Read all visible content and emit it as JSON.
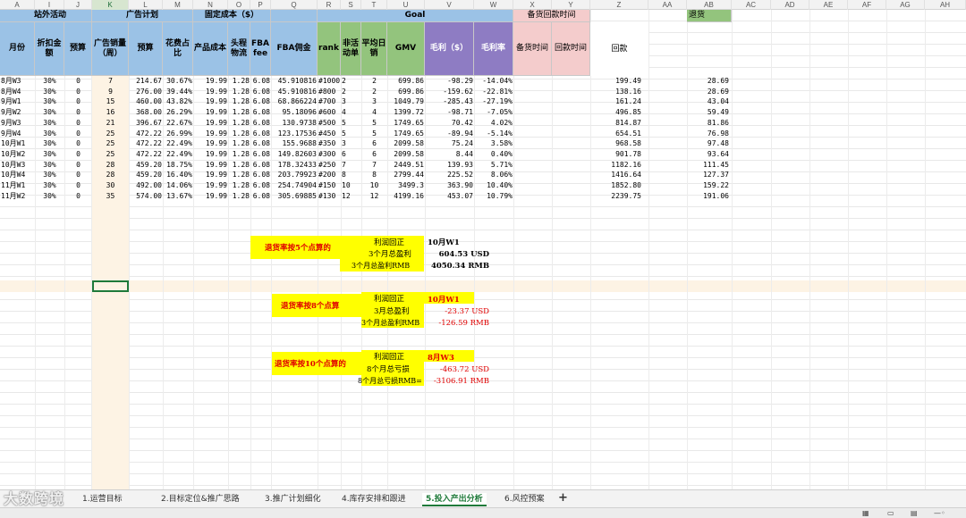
{
  "columns": [
    "A",
    "I",
    "J",
    "K",
    "L",
    "M",
    "N",
    "O",
    "P",
    "Q",
    "R",
    "S",
    "T",
    "U",
    "V",
    "W",
    "X",
    "Y",
    "Z",
    "AA",
    "AB",
    "AC",
    "AD",
    "AE",
    "AF",
    "AG",
    "AH"
  ],
  "header_groups": {
    "promo": "站外活动",
    "adplan": "广告计划",
    "fixed_cost": "固定成本（$）",
    "goal": "Goal",
    "stock_pay": "备货回款时间",
    "returns": "退货"
  },
  "header": {
    "month": "月份",
    "discount": "折扣金额",
    "budget1": "预算",
    "ad_sales": "广告销量（周）",
    "budget2": "预算",
    "ad_ratio": "花费占比",
    "product_cost": "产品成本",
    "first_leg": "头程物流",
    "fba_fee": "FBA fee",
    "fba_comm": "FBA佣金",
    "rank": "rank",
    "non_act": "非活动单",
    "avg_daily": "平均日销",
    "gmv": "GMV",
    "gp": "毛利（$）",
    "gp_rate": "毛利率",
    "stock_time": "备货时间",
    "pay_time": "回款时间",
    "payback": "回款"
  },
  "rows": [
    {
      "month": "8月W3",
      "disc": "30%",
      "b1": "0",
      "k": "7",
      "l": "214.67",
      "m": "30.67%",
      "n": "19.99",
      "o": "1.28",
      "p": "6.08",
      "q": "45.910816",
      "r": "#1000",
      "s": "2",
      "t": "2",
      "u": "699.86",
      "v": "-98.29",
      "w": "-14.04%",
      "z": "199.49",
      "ab": "28.69"
    },
    {
      "month": "8月W4",
      "disc": "30%",
      "b1": "0",
      "k": "9",
      "l": "276.00",
      "m": "39.44%",
      "n": "19.99",
      "o": "1.28",
      "p": "6.08",
      "q": "45.910816",
      "r": "#800",
      "s": "2",
      "t": "2",
      "u": "699.86",
      "v": "-159.62",
      "w": "-22.81%",
      "z": "138.16",
      "ab": "28.69"
    },
    {
      "month": "9月W1",
      "disc": "30%",
      "b1": "0",
      "k": "15",
      "l": "460.00",
      "m": "43.82%",
      "n": "19.99",
      "o": "1.28",
      "p": "6.08",
      "q": "68.866224",
      "r": "#700",
      "s": "3",
      "t": "3",
      "u": "1049.79",
      "v": "-285.43",
      "w": "-27.19%",
      "z": "161.24",
      "ab": "43.04"
    },
    {
      "month": "9月W2",
      "disc": "30%",
      "b1": "0",
      "k": "16",
      "l": "368.00",
      "m": "26.29%",
      "n": "19.99",
      "o": "1.28",
      "p": "6.08",
      "q": "95.18096",
      "r": "#600",
      "s": "4",
      "t": "4",
      "u": "1399.72",
      "v": "-98.71",
      "w": "-7.05%",
      "z": "496.85",
      "ab": "59.49"
    },
    {
      "month": "9月W3",
      "disc": "30%",
      "b1": "0",
      "k": "21",
      "l": "396.67",
      "m": "22.67%",
      "n": "19.99",
      "o": "1.28",
      "p": "6.08",
      "q": "130.9738",
      "r": "#500",
      "s": "5",
      "t": "5",
      "u": "1749.65",
      "v": "70.42",
      "w": "4.02%",
      "z": "814.87",
      "ab": "81.86"
    },
    {
      "month": "9月W4",
      "disc": "30%",
      "b1": "0",
      "k": "25",
      "l": "472.22",
      "m": "26.99%",
      "n": "19.99",
      "o": "1.28",
      "p": "6.08",
      "q": "123.17536",
      "r": "#450",
      "s": "5",
      "t": "5",
      "u": "1749.65",
      "v": "-89.94",
      "w": "-5.14%",
      "z": "654.51",
      "ab": "76.98"
    },
    {
      "month": "10月W1",
      "disc": "30%",
      "b1": "0",
      "k": "25",
      "l": "472.22",
      "m": "22.49%",
      "n": "19.99",
      "o": "1.28",
      "p": "6.08",
      "q": "155.9688",
      "r": "#350",
      "s": "3",
      "t": "6",
      "u": "2099.58",
      "v": "75.24",
      "w": "3.58%",
      "z": "968.58",
      "ab": "97.48"
    },
    {
      "month": "10月W2",
      "disc": "30%",
      "b1": "0",
      "k": "25",
      "l": "472.22",
      "m": "22.49%",
      "n": "19.99",
      "o": "1.28",
      "p": "6.08",
      "q": "149.82603",
      "r": "#300",
      "s": "6",
      "t": "6",
      "u": "2099.58",
      "v": "8.44",
      "w": "0.40%",
      "z": "901.78",
      "ab": "93.64"
    },
    {
      "month": "10月W3",
      "disc": "30%",
      "b1": "0",
      "k": "28",
      "l": "459.20",
      "m": "18.75%",
      "n": "19.99",
      "o": "1.28",
      "p": "6.08",
      "q": "178.32433",
      "r": "#250",
      "s": "7",
      "t": "7",
      "u": "2449.51",
      "v": "139.93",
      "w": "5.71%",
      "z": "1182.16",
      "ab": "111.45"
    },
    {
      "month": "10月W4",
      "disc": "30%",
      "b1": "0",
      "k": "28",
      "l": "459.20",
      "m": "16.40%",
      "n": "19.99",
      "o": "1.28",
      "p": "6.08",
      "q": "203.79923",
      "r": "#200",
      "s": "8",
      "t": "8",
      "u": "2799.44",
      "v": "225.52",
      "w": "8.06%",
      "z": "1416.64",
      "ab": "127.37"
    },
    {
      "month": "11月W1",
      "disc": "30%",
      "b1": "0",
      "k": "30",
      "l": "492.00",
      "m": "14.06%",
      "n": "19.99",
      "o": "1.28",
      "p": "6.08",
      "q": "254.74904",
      "r": "#150",
      "s": "10",
      "t": "10",
      "u": "3499.3",
      "v": "363.90",
      "w": "10.40%",
      "z": "1852.80",
      "ab": "159.22"
    },
    {
      "month": "11月W2",
      "disc": "30%",
      "b1": "0",
      "k": "35",
      "l": "574.00",
      "m": "13.67%",
      "n": "19.99",
      "o": "1.28",
      "p": "6.08",
      "q": "305.69885",
      "r": "#130",
      "s": "12",
      "t": "12",
      "u": "4199.16",
      "v": "453.07",
      "w": "10.79%",
      "z": "2239.75",
      "ab": "191.06"
    }
  ],
  "scenarios": [
    {
      "title": "退货率按5个点算的",
      "breakeven_label": "利润回正",
      "breakeven_value": "10月W1",
      "l2": "3个月总盈利",
      "v2": "604.53 USD",
      "l3": "3个月总盈利RMB",
      "v3": "4050.34 RMB"
    },
    {
      "title": "退货率按8个点算",
      "breakeven_label": "利润回正",
      "breakeven_value": "10月W1",
      "l2": "3月总盈利",
      "v2": "-23.37 USD",
      "l3": "3个月总盈利RMB",
      "v3": "-126.59 RMB"
    },
    {
      "title": "退货率按10个点算的",
      "breakeven_label": "利润回正",
      "breakeven_value": "8月W3",
      "l2": "8个月总亏损",
      "v2": "-463.72 USD",
      "l3": "8个月总亏损RMB=",
      "v3": "-3106.91 RMB"
    }
  ],
  "tabs": [
    "1.运营目标",
    "2.目标定位&推广思路",
    "3.推广计划细化",
    "4.库存安排和跟进",
    "5.投入产出分析",
    "6.风控预案"
  ],
  "active_tab": "5.投入产出分析",
  "add_tab": "+",
  "watermark": "大数跨境"
}
